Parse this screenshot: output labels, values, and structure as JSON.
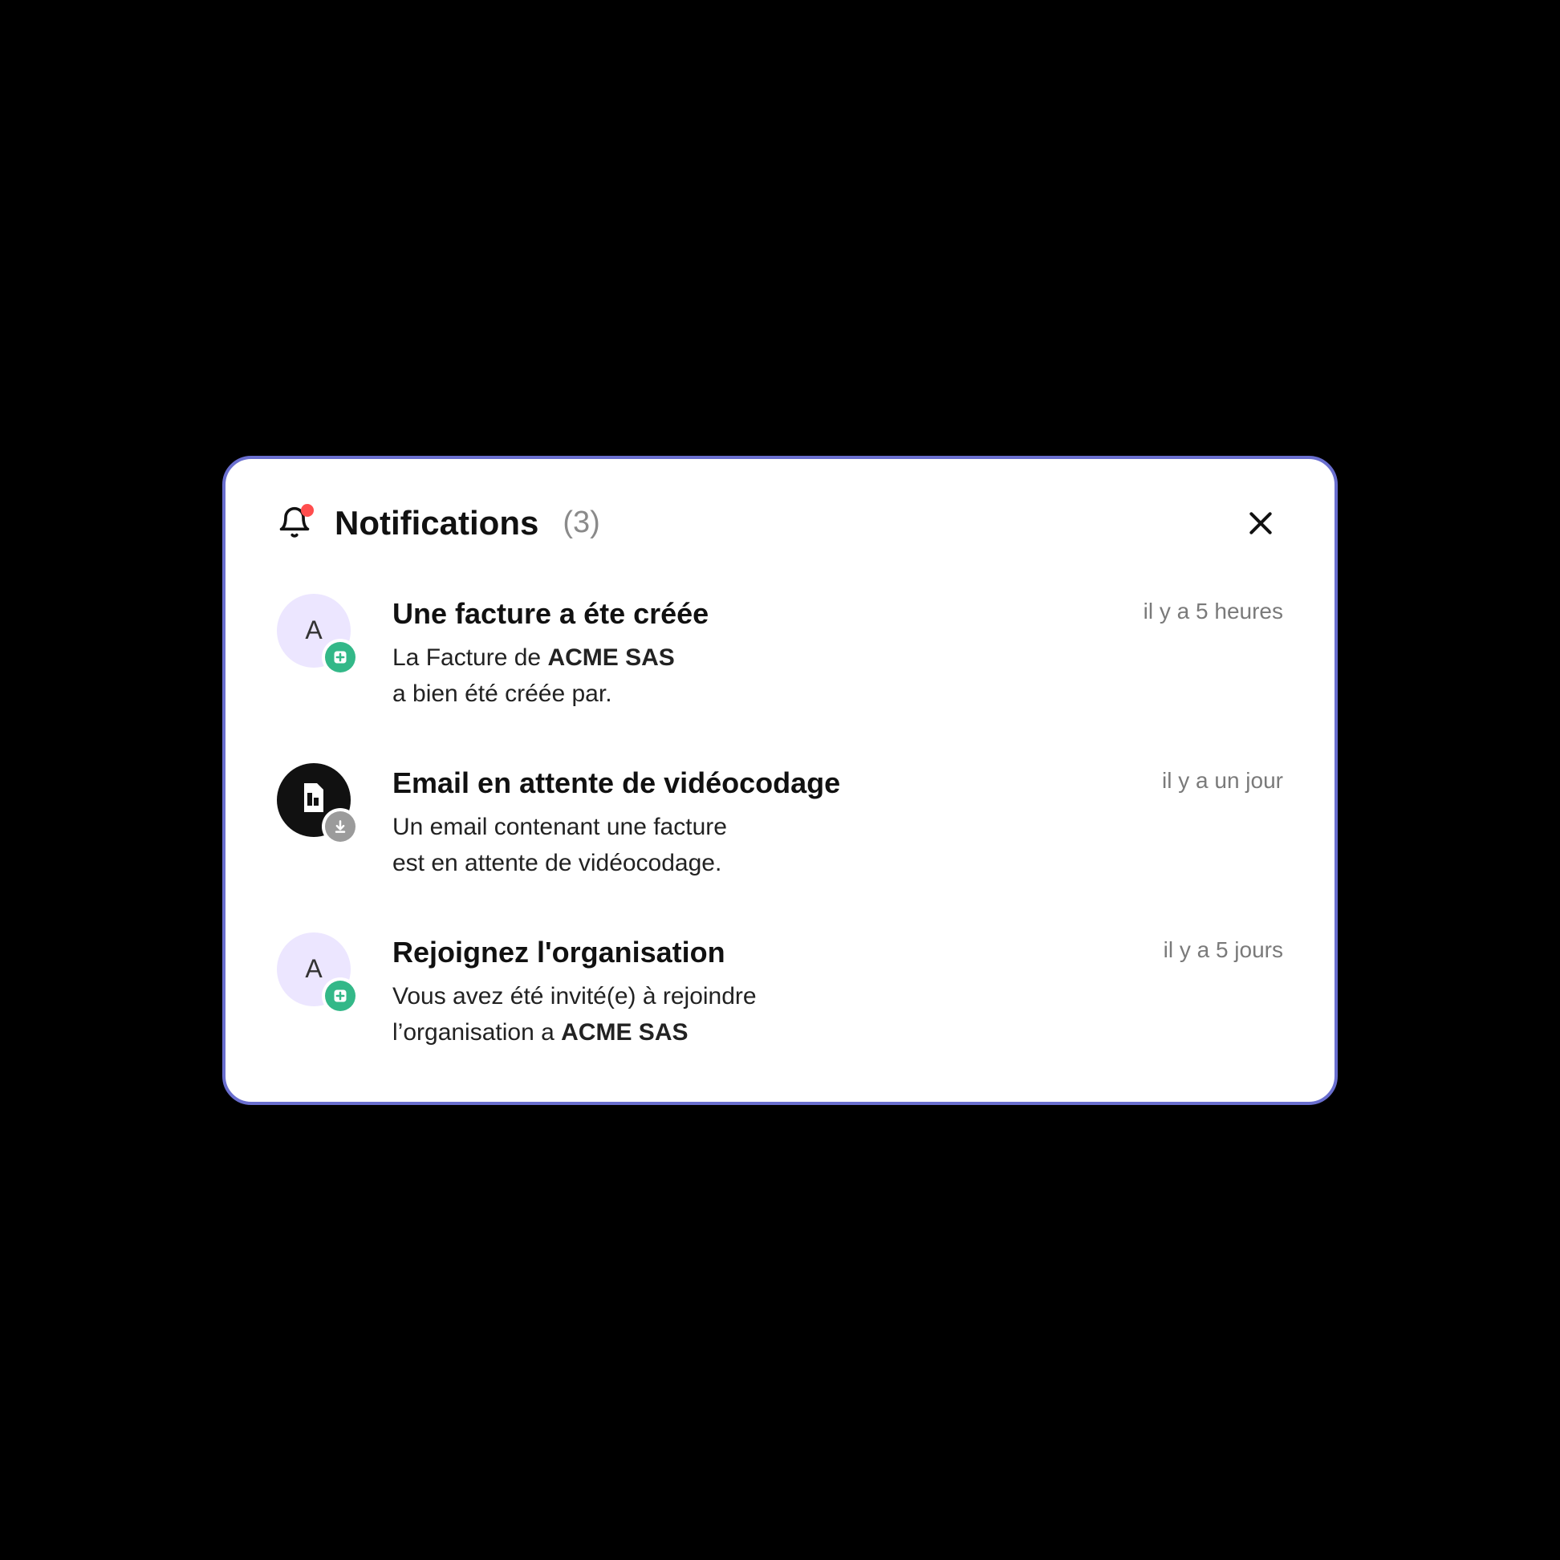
{
  "header": {
    "title": "Notifications",
    "count_display": "(3)"
  },
  "icons": {
    "bell": "bell-icon",
    "close": "close-icon",
    "plus_badge": "plus-icon",
    "download_badge": "download-icon",
    "document": "document-icon"
  },
  "notifications": [
    {
      "avatar_type": "letter",
      "avatar_letter": "A",
      "badge": "plus",
      "title": "Une facture a éte créée",
      "body_prefix": "La Facture de ",
      "body_bold": "ACME SAS",
      "body_line2": "a bien été créée par.",
      "time": "il y a 5 heures"
    },
    {
      "avatar_type": "document",
      "badge": "download",
      "title": "Email en attente de vidéocodage",
      "body_prefix": "Un email contenant une facture",
      "body_bold": "",
      "body_line2": "est en attente de vidéocodage.",
      "time": "il y a un jour"
    },
    {
      "avatar_type": "letter",
      "avatar_letter": "A",
      "badge": "plus",
      "title": "Rejoignez l'organisation",
      "body_prefix": "Vous avez été invité(e) à rejoindre",
      "body_bold": "",
      "body_line2_prefix": "l’organisation a ",
      "body_line2_bold": "ACME SAS",
      "time": "il y a 5 jours"
    }
  ]
}
